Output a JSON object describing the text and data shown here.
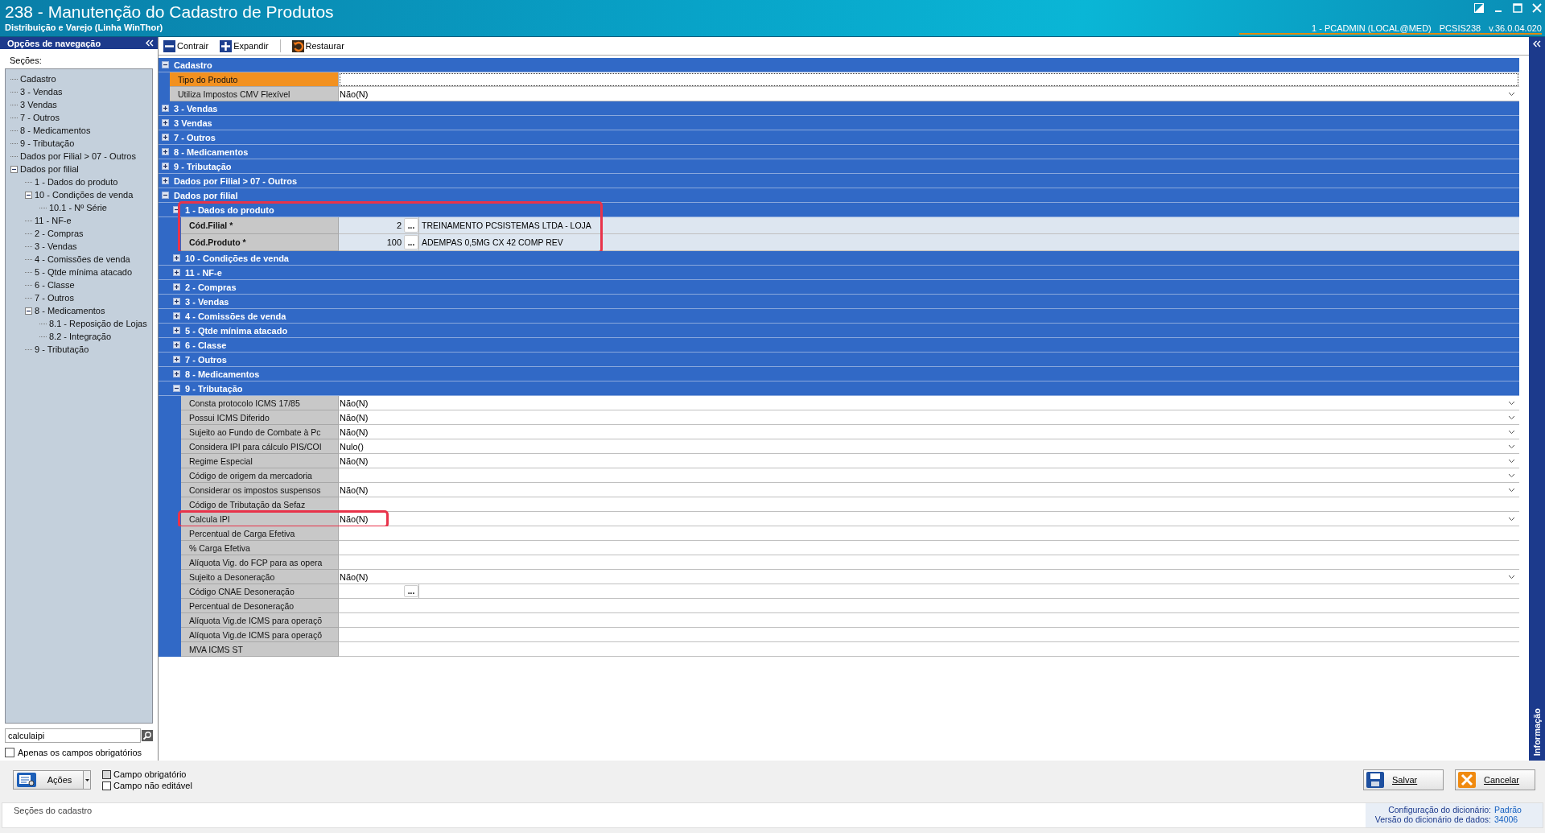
{
  "window": {
    "title": "238 - Manutenção do Cadastro de Produtos",
    "subtitle": "Distribuição e Varejo (Linha WinThor)",
    "user": "1 - PCADMIN (LOCAL@MED)",
    "program": "PCSIS238",
    "version": "v.36.0.04.020"
  },
  "nav": {
    "title": "Opções de navegação",
    "sections_label": "Seções:",
    "tree": [
      {
        "label": "Cadastro"
      },
      {
        "label": "3 - Vendas"
      },
      {
        "label": "3 Vendas"
      },
      {
        "label": "7 - Outros"
      },
      {
        "label": "8 - Medicamentos"
      },
      {
        "label": "9 - Tributação"
      },
      {
        "label": "Dados por Filial > 07 - Outros"
      },
      {
        "label": "Dados por filial",
        "expanded": true,
        "children": [
          {
            "label": "1 - Dados do produto"
          },
          {
            "label": "10 - Condições de venda",
            "expanded": true,
            "children": [
              {
                "label": "10.1 - Nº Série"
              }
            ]
          },
          {
            "label": "11 - NF-e"
          },
          {
            "label": "2 - Compras"
          },
          {
            "label": "3 - Vendas"
          },
          {
            "label": "4 - Comissões de venda"
          },
          {
            "label": "5 - Qtde mínima atacado"
          },
          {
            "label": "6 - Classe"
          },
          {
            "label": "7 - Outros"
          },
          {
            "label": "8 - Medicamentos",
            "expanded": true,
            "children": [
              {
                "label": "8.1 - Reposição de Lojas"
              },
              {
                "label": "8.2 - Integração"
              }
            ]
          },
          {
            "label": "9 - Tributação"
          }
        ]
      }
    ],
    "search": {
      "value": "calculaipi"
    },
    "only_required": {
      "label": "Apenas os campos obrigatórios",
      "checked": false
    }
  },
  "toolbar": [
    {
      "kind": "collapse",
      "label": "Contrair"
    },
    {
      "kind": "expand",
      "label": "Expandir"
    },
    {
      "kind": "restore",
      "label": "Restaurar"
    }
  ],
  "grid": {
    "rows": [
      {
        "kind": "group",
        "label": "Cadastro",
        "expanded": true,
        "highlighted": false,
        "children": [
          {
            "kind": "text",
            "label": "Tipo do Produto",
            "selected": true,
            "highlighted": false
          },
          {
            "kind": "dropdown",
            "label": "Utiliza Impostos CMV Flexível",
            "value": "Não(N)",
            "selected": false,
            "highlighted": false
          }
        ]
      },
      {
        "kind": "group",
        "label": "3 - Vendas",
        "expanded": false,
        "highlighted": false
      },
      {
        "kind": "group",
        "label": "3 Vendas",
        "expanded": false,
        "highlighted": false
      },
      {
        "kind": "group",
        "label": "7 - Outros",
        "expanded": false,
        "highlighted": false
      },
      {
        "kind": "group",
        "label": "8 - Medicamentos",
        "expanded": false,
        "highlighted": false
      },
      {
        "kind": "group",
        "label": "9 - Tributação",
        "expanded": false,
        "highlighted": false
      },
      {
        "kind": "group",
        "label": "Dados por Filial > 07 - Outros",
        "expanded": false,
        "highlighted": false
      },
      {
        "kind": "group",
        "label": "Dados por filial",
        "expanded": true,
        "highlighted": false,
        "children": [
          {
            "kind": "group",
            "label": "1 - Dados do produto",
            "expanded": true,
            "highlighted": true,
            "children": [
              {
                "kind": "lookup",
                "label": "Cód.Filial *",
                "code": "2",
                "button": "...",
                "description": "TREINAMENTO PCSISTEMAS LTDA - LOJA",
                "selected": false,
                "highlighted": false
              },
              {
                "kind": "lookup",
                "label": "Cód.Produto *",
                "code": "100",
                "button": "...",
                "description": "ADEMPAS 0,5MG CX 42 COMP REV",
                "selected": false,
                "highlighted": false
              }
            ]
          },
          {
            "kind": "group",
            "label": "10 - Condições de venda",
            "expanded": false,
            "highlighted": false
          },
          {
            "kind": "group",
            "label": "11 - NF-e",
            "expanded": false,
            "highlighted": false
          },
          {
            "kind": "group",
            "label": "2 - Compras",
            "expanded": false,
            "highlighted": false
          },
          {
            "kind": "group",
            "label": "3 - Vendas",
            "expanded": false,
            "highlighted": false
          },
          {
            "kind": "group",
            "label": "4 - Comissões de venda",
            "expanded": false,
            "highlighted": false
          },
          {
            "kind": "group",
            "label": "5 - Qtde mínima atacado",
            "expanded": false,
            "highlighted": false
          },
          {
            "kind": "group",
            "label": "6 - Classe",
            "expanded": false,
            "highlighted": false
          },
          {
            "kind": "group",
            "label": "7 - Outros",
            "expanded": false,
            "highlighted": false
          },
          {
            "kind": "group",
            "label": "8 - Medicamentos",
            "expanded": false,
            "highlighted": false
          },
          {
            "kind": "group",
            "label": "9 - Tributação",
            "expanded": true,
            "highlighted": false,
            "children": [
              {
                "kind": "dropdown",
                "label": "Consta protocolo ICMS 17/85",
                "value": "Não(N)",
                "selected": false,
                "highlighted": false
              },
              {
                "kind": "dropdown",
                "label": "Possui ICMS Diferido",
                "value": "Não(N)",
                "selected": false,
                "highlighted": false
              },
              {
                "kind": "dropdown",
                "label": "Sujeito ao Fundo de Combate à Pc",
                "value": "Não(N)",
                "selected": false,
                "highlighted": false
              },
              {
                "kind": "dropdown",
                "label": "Considera IPI para cálculo PIS/COI",
                "value": "Nulo()",
                "selected": false,
                "highlighted": false
              },
              {
                "kind": "dropdown",
                "label": "Regime Especial",
                "value": "Não(N)",
                "selected": false,
                "highlighted": false
              },
              {
                "kind": "dropdown",
                "label": "Código de origem da mercadoria",
                "selected": false,
                "highlighted": false
              },
              {
                "kind": "dropdown",
                "label": "Considerar os impostos suspensos",
                "value": "Não(N)",
                "selected": false,
                "highlighted": false
              },
              {
                "kind": "text",
                "label": "Código de Tributação da Sefaz",
                "selected": false,
                "highlighted": false
              },
              {
                "kind": "dropdown",
                "label": "Calcula IPI",
                "value": "Não(N)",
                "selected": false,
                "highlighted": true
              },
              {
                "kind": "text",
                "label": "Percentual de Carga Efetiva",
                "selected": false,
                "highlighted": false
              },
              {
                "kind": "text",
                "label": "%  Carga Efetiva",
                "selected": false,
                "highlighted": false
              },
              {
                "kind": "text",
                "label": "Alíquota Vig. do FCP para as opera",
                "selected": false,
                "highlighted": false
              },
              {
                "kind": "dropdown",
                "label": "Sujeito a Desoneração",
                "value": "Não(N)",
                "selected": false,
                "highlighted": false
              },
              {
                "kind": "lookup",
                "label": "Código CNAE Desoneração",
                "button": "...",
                "selected": false,
                "highlighted": false
              },
              {
                "kind": "text",
                "label": "Percentual de Desoneração",
                "selected": false,
                "highlighted": false
              },
              {
                "kind": "text",
                "label": "Alíquota Vig.de ICMS para operaçõ",
                "selected": false,
                "highlighted": false
              },
              {
                "kind": "text",
                "label": "Alíquota Vig.de ICMS para operaçõ",
                "selected": false,
                "highlighted": false
              },
              {
                "kind": "text",
                "label": "MVA ICMS ST",
                "selected": false,
                "highlighted": false
              }
            ]
          }
        ]
      }
    ]
  },
  "info_panel": {
    "title": "Informação"
  },
  "footer": {
    "actions": "Ações",
    "legend": [
      {
        "kind": "required",
        "label": "Campo obrigatório"
      },
      {
        "kind": "readonly",
        "label": "Campo não editável"
      }
    ],
    "save": "Salvar",
    "cancel": "Cancelar"
  },
  "status_bar": {
    "text": "Seções do cadastro",
    "config_label": "Configuração do dicionário:",
    "config": "Padrão",
    "version_label": "Versão do dicionário de dados:",
    "version": "34006"
  }
}
